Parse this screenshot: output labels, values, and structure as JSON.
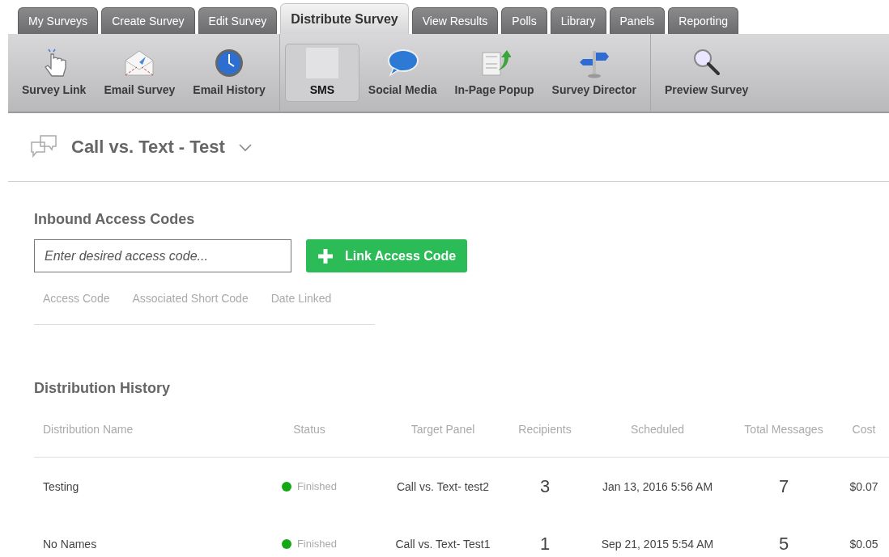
{
  "tabs": [
    {
      "label": "My Surveys",
      "selected": false
    },
    {
      "label": "Create Survey",
      "selected": false
    },
    {
      "label": "Edit Survey",
      "selected": false
    },
    {
      "label": "Distribute Survey",
      "selected": true
    },
    {
      "label": "View Results",
      "selected": false
    },
    {
      "label": "Polls",
      "selected": false
    },
    {
      "label": "Library",
      "selected": false
    },
    {
      "label": "Panels",
      "selected": false
    },
    {
      "label": "Reporting",
      "selected": false
    }
  ],
  "toolbar": {
    "groups": [
      [
        {
          "kind": "pointer",
          "label": "Survey Link",
          "selected": false
        },
        {
          "kind": "envelope",
          "label": "Email Survey",
          "selected": false
        },
        {
          "kind": "clock",
          "label": "Email History",
          "selected": false
        }
      ],
      [
        {
          "kind": "blank",
          "label": "SMS",
          "selected": true
        },
        {
          "kind": "bubble",
          "label": "Social Media",
          "selected": false
        },
        {
          "kind": "popup",
          "label": "In-Page Popup",
          "selected": false
        },
        {
          "kind": "signpost",
          "label": "Survey Director",
          "selected": false
        }
      ],
      [
        {
          "kind": "magnifier",
          "label": "Preview Survey",
          "selected": false
        }
      ]
    ]
  },
  "survey": {
    "title": "Call vs. Text - Test"
  },
  "access_codes": {
    "heading": "Inbound Access Codes",
    "input": {
      "placeholder": "Enter desired access code..."
    },
    "button": "Link Access Code",
    "columns": [
      "Access Code",
      "Associated Short Code",
      "Date Linked"
    ]
  },
  "history": {
    "heading": "Distribution History",
    "columns": [
      "Distribution Name",
      "Status",
      "Target Panel",
      "Recipients",
      "Scheduled",
      "Total Messages",
      "Cost"
    ],
    "rows": [
      {
        "name": "Testing",
        "status": "Finished",
        "panel": "Call vs. Text- test2",
        "recipients": "3",
        "scheduled": "Jan 13, 2016 5:56 AM",
        "messages": "7",
        "cost": "$0.07"
      },
      {
        "name": "No Names",
        "status": "Finished",
        "panel": "Call vs. Text- Test1",
        "recipients": "1",
        "scheduled": "Sep 21, 2015 5:54 AM",
        "messages": "5",
        "cost": "$0.05"
      }
    ]
  }
}
